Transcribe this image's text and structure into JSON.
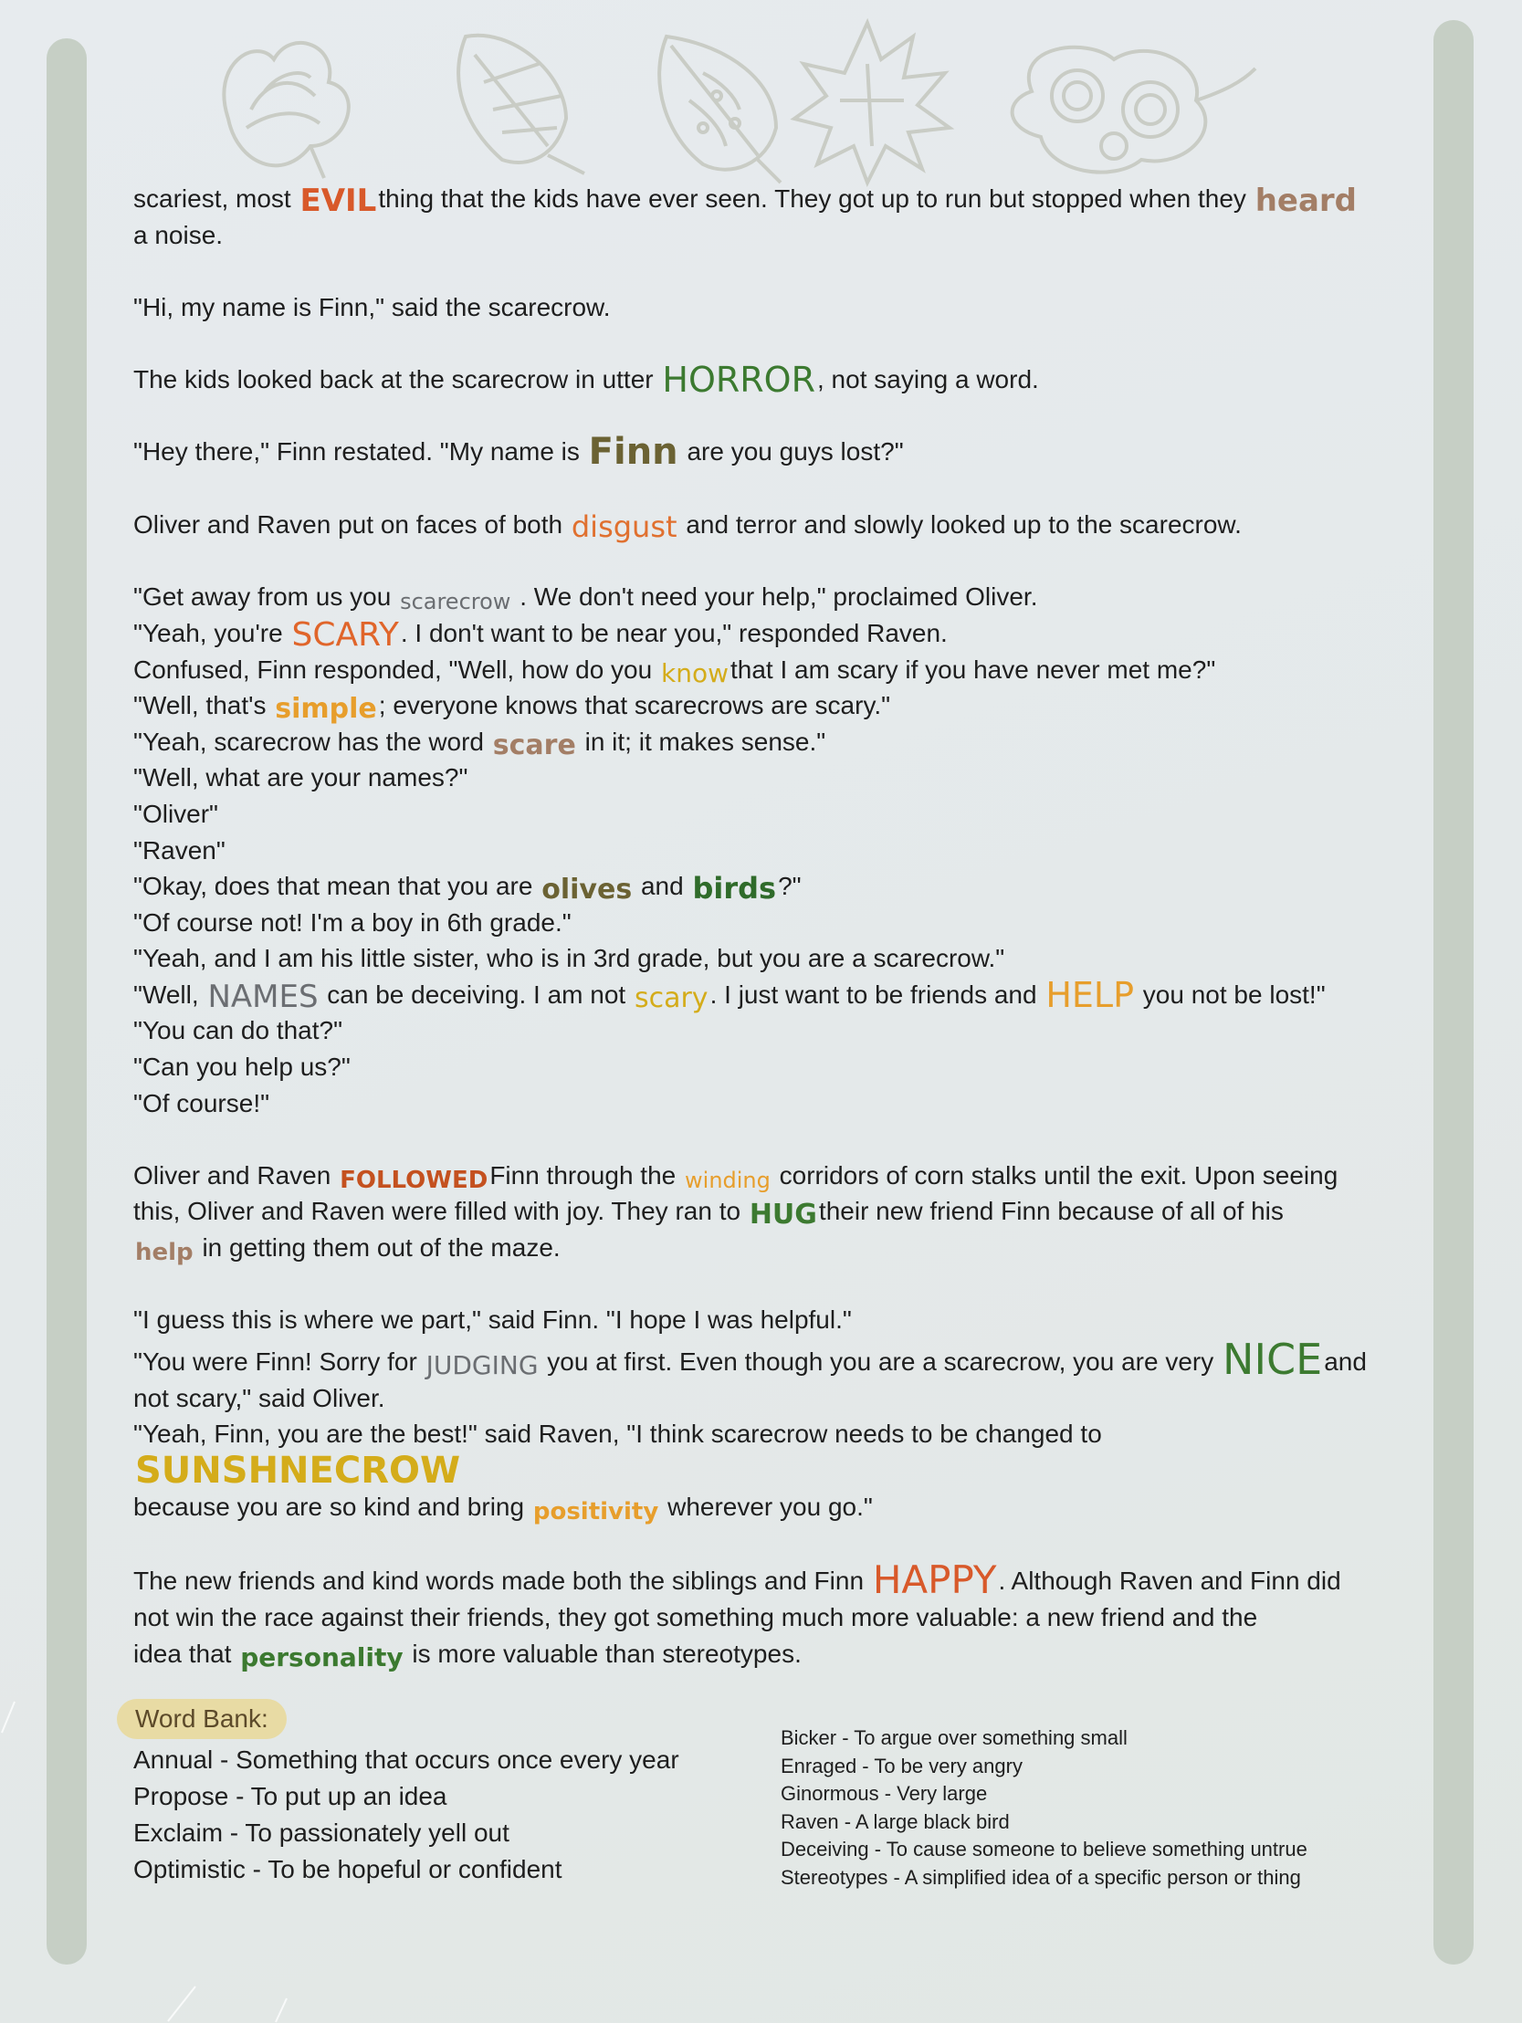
{
  "colors": {
    "background": "#e5e9ec",
    "bars": "#c6cfc5",
    "leaf_outline": "#c9ccc5",
    "word_bank_highlight": "#e8dba4",
    "orange": "#d86d2a",
    "rust": "#c4511f",
    "green": "#3c7a30",
    "dark_green": "#2f6b2a",
    "brown": "#a37e66",
    "yellow": "#d4ac1a",
    "gold": "#e79e2c",
    "gray": "#6b6e72",
    "olive": "#6b6233"
  },
  "decorations": {
    "leaves": [
      "leaf-icon",
      "leaf-icon",
      "leaf-icon",
      "leaf-icon",
      "leaf-icon"
    ]
  },
  "story": [
    [
      {
        "t": "scariest, most "
      },
      {
        "w": "EVIL",
        "c": "#d8592a",
        "s": 34
      },
      {
        "t": "thing that the kids have ever seen. They got up to run but stopped when they "
      },
      {
        "w": "heard",
        "c": "#a37e66",
        "s": 34
      }
    ],
    [
      {
        "t": "a noise."
      }
    ],
    [],
    [
      {
        "t": "\"Hi, my name is Finn,\" said the scarecrow."
      }
    ],
    [],
    [
      {
        "t": "The kids looked back at the scarecrow in utter "
      },
      {
        "w": "HORROR",
        "c": "#3c7a30",
        "s": 38,
        "thin": true
      },
      {
        "t": ", not saying a word."
      }
    ],
    [],
    [
      {
        "t": "\"Hey there,\" Finn restated. \"My name is "
      },
      {
        "w": "Finn",
        "c": "#6b6233",
        "s": 40
      },
      {
        "t": " are you guys lost?\""
      }
    ],
    [],
    [
      {
        "t": "Oliver and Raven put on faces of both "
      },
      {
        "w": "disgust",
        "c": "#e0702f",
        "s": 32,
        "thin": true
      },
      {
        "t": " and terror and slowly looked up to the scarecrow."
      }
    ],
    [],
    [
      {
        "t": "\"Get away from us you "
      },
      {
        "w": "scarecrow",
        "c": "#6b6e72",
        "s": 24,
        "thin": true
      },
      {
        "t": " . We don't need your help,\" proclaimed Oliver."
      }
    ],
    [
      {
        "t": "\"Yeah, you're "
      },
      {
        "w": "SCARY",
        "c": "#e0652a",
        "s": 36,
        "thin": true
      },
      {
        "t": ". I don't want to be near you,\" responded Raven."
      }
    ],
    [
      {
        "t": "Confused, Finn responded, \"Well, how do you "
      },
      {
        "w": "know",
        "c": "#d4ac1a",
        "s": 28,
        "thin": true
      },
      {
        "t": "that I am scary if you have never met me?\""
      }
    ],
    [
      {
        "t": "\"Well, that's "
      },
      {
        "w": "simple",
        "c": "#e79e2c",
        "s": 30
      },
      {
        "t": "; everyone knows that scarecrows are scary.\""
      }
    ],
    [
      {
        "t": "\"Yeah, scarecrow has the word "
      },
      {
        "w": "scare",
        "c": "#a37e66",
        "s": 30
      },
      {
        "t": " in it; it makes sense.\""
      }
    ],
    [
      {
        "t": "\"Well, what are your names?\""
      }
    ],
    [
      {
        "t": "\"Oliver\""
      }
    ],
    [
      {
        "t": "\"Raven\""
      }
    ],
    [
      {
        "t": "\"Okay, does that mean that you are "
      },
      {
        "w": "olives",
        "c": "#6b6233",
        "s": 30
      },
      {
        "t": " and "
      },
      {
        "w": "birds",
        "c": "#2f6b2a",
        "s": 32
      },
      {
        "t": "?\""
      }
    ],
    [
      {
        "t": "\"Of course not! I'm a boy in 6th grade.\""
      }
    ],
    [
      {
        "t": "\"Yeah, and I am his little sister, who is in 3rd grade, but you are a scarecrow.\""
      }
    ],
    [
      {
        "t": "\"Well, "
      },
      {
        "w": "NAMES",
        "c": "#6b6e72",
        "s": 34,
        "thin": true
      },
      {
        "t": " can be deceiving. I am not "
      },
      {
        "w": "scary",
        "c": "#d4ac1a",
        "s": 30,
        "thin": true
      },
      {
        "t": ". I just want to be friends and "
      },
      {
        "w": "HELP",
        "c": "#e79e2c",
        "s": 38,
        "thin": true
      },
      {
        "t": " you not be lost!\""
      }
    ],
    [
      {
        "t": "\"You can do that?\""
      }
    ],
    [
      {
        "t": "\"Can you help us?\""
      }
    ],
    [
      {
        "t": "\"Of course!\""
      }
    ],
    [],
    [
      {
        "t": "Oliver and Raven "
      },
      {
        "w": "FOLLOWED",
        "c": "#c4511f",
        "s": 26
      },
      {
        "t": "Finn through the "
      },
      {
        "w": "winding",
        "c": "#e79e2c",
        "s": 24,
        "thin": true
      },
      {
        "t": " corridors of corn stalks until the exit. Upon seeing"
      }
    ],
    [
      {
        "t": "this, Oliver and Raven were filled with joy. They ran to "
      },
      {
        "w": "HUG",
        "c": "#3c7a30",
        "s": 30
      },
      {
        "t": "their new friend Finn because of all of his"
      }
    ],
    [
      {
        "w": "help",
        "c": "#a37e66",
        "s": 26
      },
      {
        "t": " in getting them out of the maze."
      }
    ],
    [],
    [
      {
        "t": "\"I guess this is where we part,\" said Finn. \"I hope I was helpful.\""
      }
    ],
    [
      {
        "t": "\"You were Finn! Sorry for "
      },
      {
        "w": "JUDGING",
        "c": "#6b6e72",
        "s": 28,
        "thin": true
      },
      {
        "t": " you at first. Even though you are a scarecrow, you are very "
      },
      {
        "w": "NICE",
        "c": "#3c7a30",
        "s": 46,
        "thin": true
      },
      {
        "t": "and"
      }
    ],
    [
      {
        "t": "not scary,\" said Oliver."
      }
    ],
    [
      {
        "t": "\"Yeah, Finn, you are the best!\" said Raven, \"I think scarecrow needs to be changed to "
      },
      {
        "w": "SUNSHNECROW",
        "c": "#d4ac1a",
        "s": 40
      }
    ],
    [
      {
        "t": "because you are so kind and bring "
      },
      {
        "w": "positivity",
        "c": "#e79e2c",
        "s": 26
      },
      {
        "t": " wherever you go.\""
      }
    ],
    [],
    [
      {
        "t": "The new friends and kind words made both the siblings and Finn "
      },
      {
        "w": "HAPPY",
        "c": "#d8592a",
        "s": 42,
        "thin": true
      },
      {
        "t": ". Although Raven and Finn did"
      }
    ],
    [
      {
        "t": "not win the race against their friends, they got something much more valuable: a new friend and the"
      }
    ],
    [
      {
        "t": "idea that "
      },
      {
        "w": "personality",
        "c": "#3c7a30",
        "s": 28
      },
      {
        "t": " is more valuable than stereotypes."
      }
    ]
  ],
  "word_bank": {
    "title": "Word Bank:",
    "left": [
      "Annual - Something that occurs once every year",
      "Propose - To put up an idea",
      "Exclaim - To passionately yell out",
      "Optimistic - To be hopeful or confident"
    ],
    "right": [
      "Bicker - To argue over something small",
      "Enraged - To be very angry",
      "Ginormous - Very large",
      "Raven - A large black bird",
      "Deceiving - To cause someone to believe something untrue",
      "Stereotypes - A simplified idea of a specific person or thing"
    ]
  }
}
